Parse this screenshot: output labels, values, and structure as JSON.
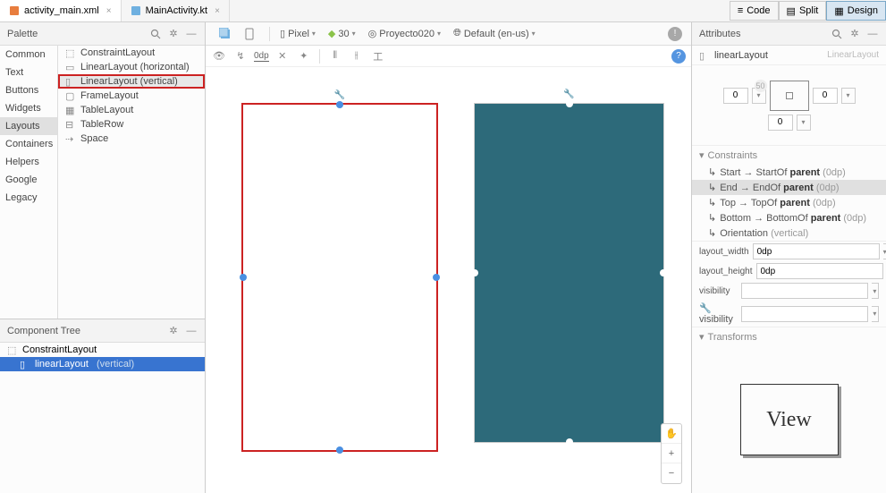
{
  "tabs": {
    "file1": "activity_main.xml",
    "file2": "MainActivity.kt"
  },
  "viewModes": {
    "code": "Code",
    "split": "Split",
    "design": "Design"
  },
  "palette": {
    "title": "Palette",
    "categories": [
      "Common",
      "Text",
      "Buttons",
      "Widgets",
      "Layouts",
      "Containers",
      "Helpers",
      "Google",
      "Legacy"
    ],
    "components": [
      "ConstraintLayout",
      "LinearLayout (horizontal)",
      "LinearLayout (vertical)",
      "FrameLayout",
      "TableLayout",
      "TableRow",
      "Space"
    ]
  },
  "designBar": {
    "device": "Pixel",
    "api": "30",
    "theme": "Proyecto020",
    "locale": "Default (en-us)",
    "margin": "0dp"
  },
  "componentTree": {
    "title": "Component Tree",
    "root": "ConstraintLayout",
    "child": "linearLayout",
    "childType": "(vertical)"
  },
  "attributes": {
    "title": "Attributes",
    "selectedName": "linearLayout",
    "selectedType": "LinearLayout",
    "constraintVal": "0",
    "sliderLabel": "50",
    "constraintsHead": "Constraints",
    "c1_a": "Start → StartOf ",
    "c1_b": "parent",
    "c1_c": " (0dp)",
    "c2_a": "End → EndOf ",
    "c2_b": "parent",
    "c2_c": " (0dp)",
    "c3_a": "Top → TopOf ",
    "c3_b": "parent",
    "c3_c": " (0dp)",
    "c4_a": "Bottom → BottomOf ",
    "c4_b": "parent",
    "c4_c": " (0dp)",
    "c5_a": "Orientation",
    "c5_c": "(vertical)",
    "layoutWidthLabel": "layout_width",
    "layoutWidthVal": "0dp",
    "layoutHeightLabel": "layout_height",
    "layoutHeightVal": "0dp",
    "visibilityLabel": "visibility",
    "fvisibilityLabel": "visibility",
    "transformsHead": "Transforms",
    "viewPreview": "View"
  }
}
